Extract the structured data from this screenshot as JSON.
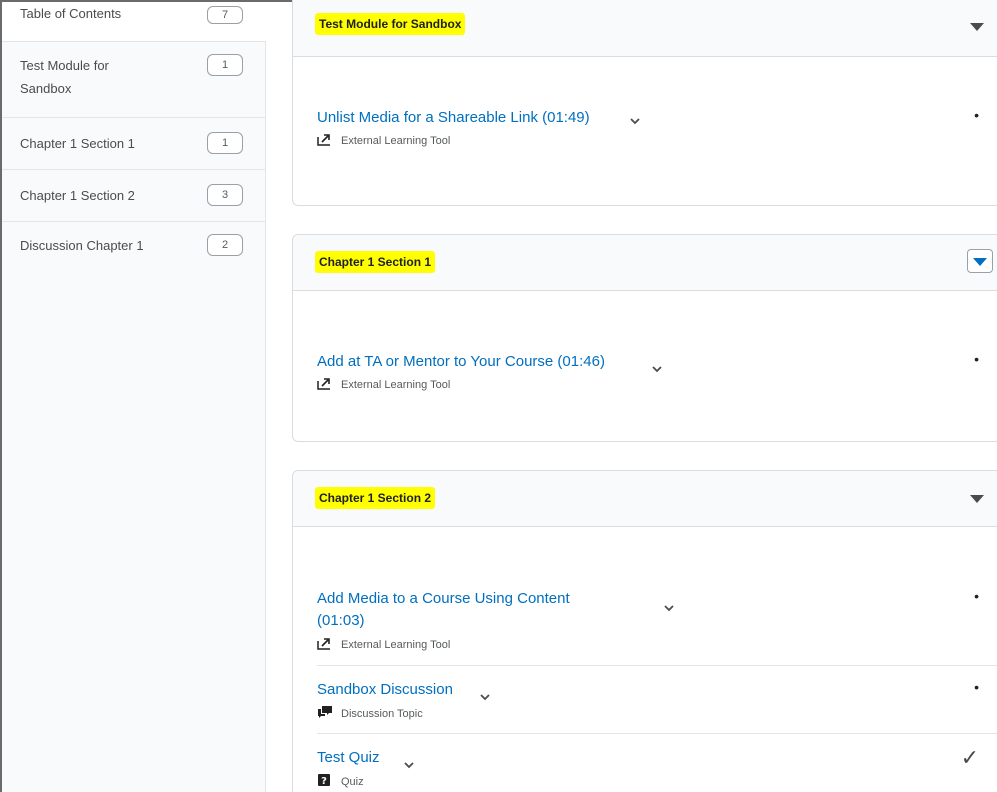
{
  "sidebar": {
    "items": [
      {
        "label": "Table of Contents",
        "count": "7"
      },
      {
        "label": "Test Module for Sandbox",
        "count": "1"
      },
      {
        "label": "Chapter 1 Section 1",
        "count": "1"
      },
      {
        "label": "Chapter 1 Section 2",
        "count": "3"
      },
      {
        "label": "Discussion Chapter 1",
        "count": "2"
      }
    ]
  },
  "modules": [
    {
      "title": "Test Module for Sandbox",
      "items": [
        {
          "title": "Unlist Media for a Shareable Link (01:49)",
          "type": "External Learning Tool",
          "icon": "external-tool-icon",
          "status": "•"
        }
      ]
    },
    {
      "title": "Chapter 1 Section 1",
      "items": [
        {
          "title": "Add at TA or Mentor to Your Course (01:46)",
          "type": "External Learning Tool",
          "icon": "external-tool-icon",
          "status": "•"
        }
      ]
    },
    {
      "title": "Chapter 1 Section 2",
      "items": [
        {
          "title_line1": "Add Media to a Course Using Content",
          "title_line2": "(01:03)",
          "type": "External Learning Tool",
          "icon": "external-tool-icon",
          "status": "•"
        },
        {
          "title": "Sandbox Discussion",
          "type": "Discussion Topic",
          "icon": "discussion-icon",
          "status": "•"
        },
        {
          "title": "Test Quiz",
          "type": "Quiz",
          "icon": "quiz-icon",
          "status": "✓"
        }
      ]
    }
  ],
  "colors": {
    "link": "#006fbf",
    "highlight": "#ffff00",
    "border": "#d9dde1"
  }
}
